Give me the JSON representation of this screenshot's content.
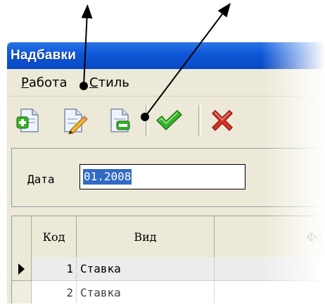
{
  "window": {
    "title": "Надбавки"
  },
  "menu": {
    "items": [
      "Работа",
      "Стиль"
    ]
  },
  "toolbar": {
    "buttons": [
      {
        "name": "add-record-button",
        "icon": "add-doc-icon"
      },
      {
        "name": "edit-record-button",
        "icon": "edit-doc-icon"
      },
      {
        "name": "delete-record-button",
        "icon": "remove-doc-icon"
      },
      {
        "name": "confirm-button",
        "icon": "checkmark-icon"
      },
      {
        "name": "cancel-button",
        "icon": "cross-icon"
      }
    ]
  },
  "filter": {
    "date_label": "Дата",
    "date_value": "01.2008"
  },
  "grid": {
    "columns": [
      "Код",
      "Вид",
      "Фо"
    ],
    "rows": [
      {
        "code": "1",
        "kind": "Ставка",
        "current": true
      },
      {
        "code": "2",
        "kind": "Ставка",
        "current": false
      }
    ]
  },
  "colors": {
    "titlebar": "#0d57d8",
    "selection": "#316ac5",
    "window_bg": "#ece9d8",
    "plus_green": "#3cae2a",
    "check_green": "#35b12e",
    "cross_red": "#d9342a"
  }
}
